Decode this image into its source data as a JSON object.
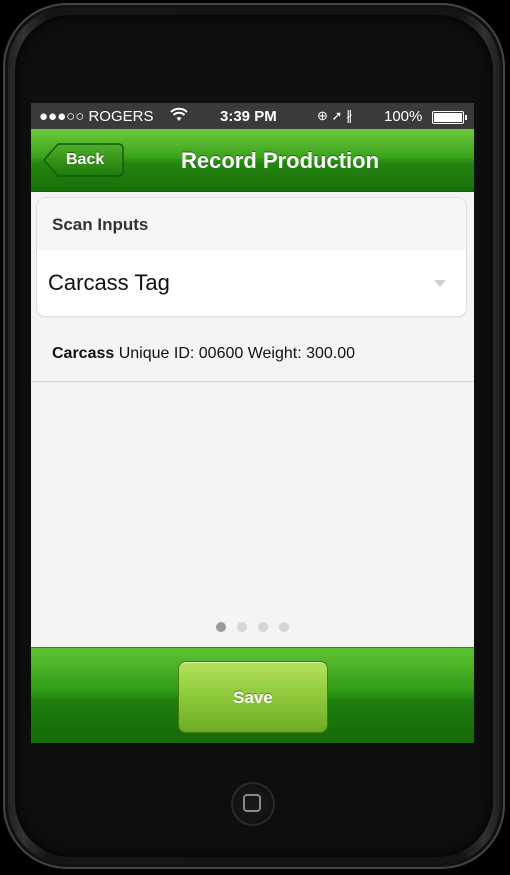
{
  "status_bar": {
    "carrier": "●●●○○ ROGERS",
    "wifi_icon": "wifi-icon",
    "time": "3:39 PM",
    "indicators": "⊕ ➚ ∦",
    "battery_percent": "100%",
    "battery_level": 1.0
  },
  "navbar": {
    "back_label": "Back",
    "title": "Record Production"
  },
  "scan_inputs": {
    "header": "Scan Inputs",
    "selected": "Carcass Tag"
  },
  "result": {
    "type": "Carcass",
    "details": " Unique ID: 00600 Weight: 300.00"
  },
  "pager": {
    "count": 4,
    "active_index": 0
  },
  "footer": {
    "save_label": "Save"
  },
  "colors": {
    "nav_green": "#3aa41c",
    "save_green": "#8cc83a"
  }
}
